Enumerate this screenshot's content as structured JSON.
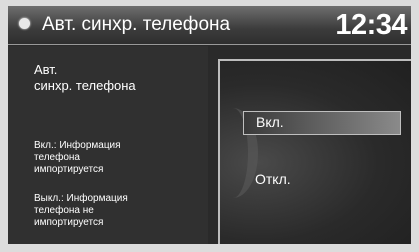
{
  "header": {
    "title": "Авт. синхр. телефона",
    "clock": "12:34"
  },
  "info": {
    "title_line1": "Авт.",
    "title_line2": "синхр. телефона",
    "on_note": [
      "Вкл.: Информация",
      "телефона",
      "импортируется"
    ],
    "off_note": [
      "Выкл.: Информация",
      "телефона не",
      "импортируется"
    ]
  },
  "options": {
    "on_label": "Вкл.",
    "off_label": "Откл.",
    "selected": "Вкл."
  }
}
